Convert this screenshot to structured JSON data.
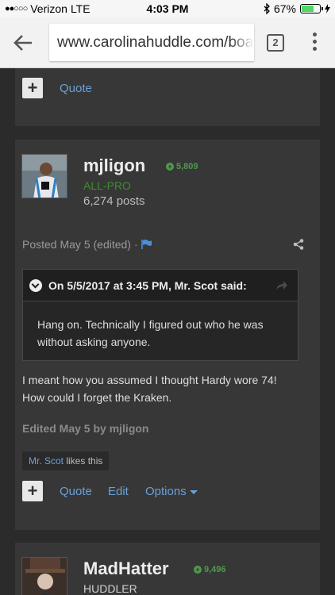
{
  "status_bar": {
    "carrier": "Verizon",
    "network": "LTE",
    "time": "4:03 PM",
    "battery": "67%",
    "battery_level": 0.67
  },
  "browser": {
    "url": "www.carolinahuddle.com/boa",
    "tab_count": "2"
  },
  "top_post": {
    "quote_label": "Quote"
  },
  "post": {
    "username": "mjligon",
    "reputation": "5,809",
    "rank": "ALL-PRO",
    "post_count": "6,274 posts",
    "posted": "Posted May 5 (edited)",
    "quote": {
      "header": "On 5/5/2017 at 3:45 PM, Mr. Scot said:",
      "text": "Hang on. Technically I figured out who he was without asking anyone."
    },
    "body_line1": "I meant how you assumed I thought Hardy wore 74!",
    "body_line2": "How could I forget the Kraken.",
    "edited_note": "Edited May 5 by mjligon",
    "liker": "Mr. Scot",
    "likes_suffix": " likes this",
    "actions": {
      "quote": "Quote",
      "edit": "Edit",
      "options": "Options"
    }
  },
  "next_post": {
    "username": "MadHatter",
    "reputation": "9,496",
    "rank": "HUDDLER"
  },
  "colors": {
    "background": "#2b2b2b",
    "post_bg": "#373737",
    "link": "#6aa1d8",
    "rep_green": "#4e9a4e"
  }
}
